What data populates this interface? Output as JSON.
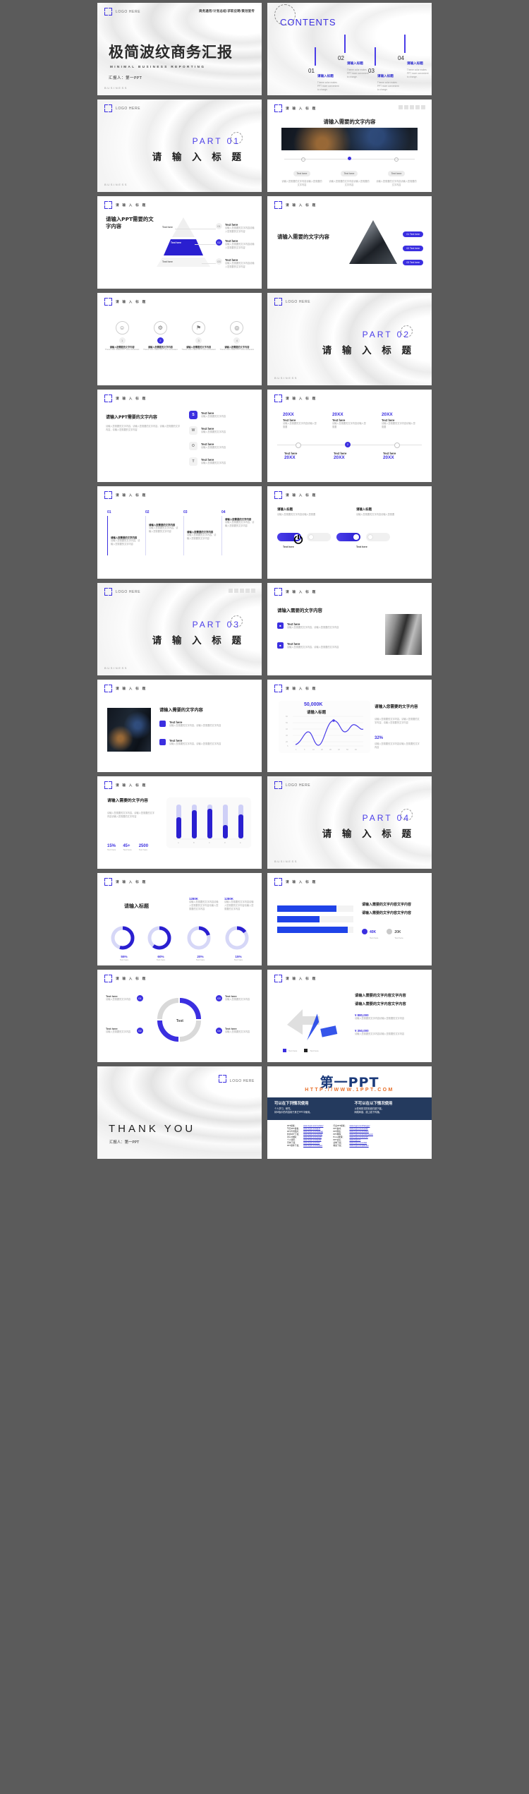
{
  "brand": {
    "accent": "#3b2fe0",
    "navy": "#243a5e",
    "orange": "#e8702a"
  },
  "common": {
    "logo_here": "LOGO HERE",
    "header_title": "请 输 入 标 题",
    "business": "BUSINESS",
    "text_here": "Text here",
    "placeholder_en": "Theme color makes PPT more convenient to change.",
    "placeholder_cn": "请输入您需要的文字内容，请输入您需要的文字内容，请输入您需要的文字内容"
  },
  "slides": [
    {
      "id": "cover",
      "tagline": "商务通用/计划总结/求职应聘/策划宣传",
      "title": "极简波纹商务汇报",
      "subtitle": "MINIMAL BUSINESS REPORTING",
      "presenter": "汇报人：第一PPT"
    },
    {
      "id": "contents",
      "title": "CONTENTS",
      "items": [
        {
          "num": "01",
          "label": "请输入标题",
          "desc": "Theme color makes PPT more convenient to change."
        },
        {
          "num": "02",
          "label": "请输入标题",
          "desc": "Theme color makes PPT more convenient to change."
        },
        {
          "num": "03",
          "label": "请输入标题",
          "desc": "Theme color makes PPT more convenient to change."
        },
        {
          "num": "04",
          "label": "请输入标题",
          "desc": "Theme color makes PPT more convenient to change."
        }
      ]
    },
    {
      "id": "part01",
      "part": "PART 01",
      "title": "请 输 入 标 题"
    },
    {
      "id": "city-cards",
      "title": "请输入需要的文字内容",
      "cards": [
        {
          "label": "Text here",
          "desc": "请输入您需要的文字内容请输入您需要的文字内容"
        },
        {
          "label": "Text here",
          "desc": "请输入您需要的文字内容请输入您需要的文字内容"
        },
        {
          "label": "Text here",
          "desc": "请输入您需要的文字内容请输入您需要的文字内容"
        }
      ]
    },
    {
      "id": "pyramid",
      "title": "请输入PPT需要的文字内容",
      "levels": [
        {
          "label": "Text here"
        },
        {
          "label": "Text here"
        },
        {
          "label": "Text here"
        }
      ],
      "rows": [
        {
          "num": "01",
          "label": "Text here",
          "desc": "请输入您需要的文字内容请输入您需要的文字内容"
        },
        {
          "num": "02",
          "label": "Text here",
          "desc": "请输入您需要的文字内容请输入您需要的文字内容"
        },
        {
          "num": "03",
          "label": "Text here",
          "desc": "请输入您需要的文字内容请输入您需要的文字内容"
        }
      ]
    },
    {
      "id": "triangle-photo",
      "title": "请输入需要的文字内容",
      "tags": [
        {
          "label": "01 Text here"
        },
        {
          "label": "02 Text here"
        },
        {
          "label": "03 Text here"
        }
      ]
    },
    {
      "id": "four-icons",
      "icons": [
        {
          "glyph": "☺",
          "num": "1",
          "label": "请输入您需要的文字内容",
          "desc": "Theme color makes PPT more convenient"
        },
        {
          "glyph": "⚙",
          "num": "2",
          "label": "请输入您需要的文字内容",
          "desc": "Theme color makes PPT more convenient"
        },
        {
          "glyph": "⚑",
          "num": "3",
          "label": "请输入您需要的文字内容",
          "desc": "Theme color makes PPT more convenient"
        },
        {
          "glyph": "◎",
          "num": "4",
          "label": "请输入您需要的文字内容",
          "desc": "Theme color makes PPT more convenient"
        }
      ]
    },
    {
      "id": "part02",
      "part": "PART 02",
      "title": "请 输 入 标 题"
    },
    {
      "id": "swot",
      "title": "请输入PPT需要的文字内容",
      "desc": "请输入您需要的文字内容，请输入您需要的文字内容，请输入您需要的文字内容，请输入您需要的文字内容",
      "items": [
        {
          "key": "S",
          "label": "Text here",
          "desc": "请输入您需要的文字内容"
        },
        {
          "key": "W",
          "label": "Text here",
          "desc": "请输入您需要的文字内容"
        },
        {
          "key": "O",
          "label": "Text here",
          "desc": "请输入您需要的文字内容"
        },
        {
          "key": "T",
          "label": "Text here",
          "desc": "请输入您需要的文字内容"
        }
      ]
    },
    {
      "id": "timeline",
      "top": [
        {
          "year": "20XX",
          "label": "Text here",
          "desc": "请输入您需要的文字内容请输入您需要"
        },
        {
          "year": "20XX",
          "label": "Text here",
          "desc": "请输入您需要的文字内容请输入您需要"
        },
        {
          "year": "20XX",
          "label": "Text here",
          "desc": "请输入您需要的文字内容请输入您需要"
        }
      ],
      "bottom": [
        {
          "year": "20XX",
          "label": "Text here"
        },
        {
          "year": "20XX",
          "label": "Text here"
        },
        {
          "year": "20XX",
          "label": "Text here"
        }
      ]
    },
    {
      "id": "steps",
      "items": [
        {
          "num": "01",
          "label": "请输入您需要的文字内容",
          "desc": "请输入您需要的文字内容，请输入您需要的文字内容"
        },
        {
          "num": "02",
          "label": "请输入您需要的文字内容",
          "desc": "请输入您需要的文字内容，请输入您需要的文字内容"
        },
        {
          "num": "03",
          "label": "请输入您需要的文字内容",
          "desc": "请输入您需要的文字内容，请输入您需要的文字内容"
        },
        {
          "num": "04",
          "label": "请输入您需要的文字内容",
          "desc": "请输入您需要的文字内容，请输入您需要的文字内容"
        }
      ]
    },
    {
      "id": "toggles",
      "headers": [
        {
          "label": "请输入标题",
          "desc": "请输入您需要的文字内容请输入您需要"
        },
        {
          "label": "请输入标题",
          "desc": "请输入您需要的文字内容请输入您需要"
        }
      ],
      "toggles": [
        {
          "state": "on",
          "label": "Text here"
        },
        {
          "state": "off",
          "label": ""
        },
        {
          "state": "on",
          "label": "Text here"
        },
        {
          "state": "off",
          "label": ""
        }
      ]
    },
    {
      "id": "part03",
      "part": "PART 03",
      "title": "请 输 入 标 题"
    },
    {
      "id": "list-photo",
      "title": "请输入需要的文字内容",
      "items": [
        {
          "label": "Text here",
          "desc": "请输入您需要的文字内容，请输入您需要的文字内容"
        },
        {
          "label": "Text here",
          "desc": "请输入您需要的文字内容，请输入您需要的文字内容"
        }
      ]
    },
    {
      "id": "photo-list",
      "title": "请输入需要的文字内容",
      "items": [
        {
          "label": "Text here",
          "desc": "请输入您需要的文字内容，请输入您需要的文字内容"
        },
        {
          "label": "Text here",
          "desc": "请输入您需要的文字内容，请输入您需要的文字内容"
        }
      ]
    },
    {
      "id": "line-chart",
      "value": "50,000K",
      "value_label": "请输入标题",
      "side_title": "请输入您需要的文字内容",
      "sub_value": "32%",
      "sub_label": "请输入您需要的文字内容请输入您需要的文字内容"
    },
    {
      "id": "bar-chart",
      "title": "请输入需要的文字内容",
      "desc": "请输入您需要的文字内容，请输入您需要的文字内容请输入您需要的文字内容",
      "stats": [
        {
          "value": "15%",
          "label": "Text here"
        },
        {
          "value": "45+",
          "label": "Text here"
        },
        {
          "value": "2500",
          "label": "Text here"
        }
      ]
    },
    {
      "id": "part04",
      "part": "PART 04",
      "title": "请 输 入 标 题"
    },
    {
      "id": "donuts",
      "title": "请输入标题",
      "notes": [
        {
          "value": "1280K",
          "desc": "请输入您需要的文字内容请输入您需要的文字内容请输入您需要的文字内容"
        },
        {
          "value": "1280K",
          "desc": "请输入您需要的文字内容请输入您需要的文字内容请输入您需要的文字内容"
        }
      ],
      "items": [
        {
          "pct": "55%",
          "value": 55,
          "label": "Text here"
        },
        {
          "pct": "60%",
          "value": 60,
          "label": "Text here"
        },
        {
          "pct": "20%",
          "value": 20,
          "label": "Text here"
        },
        {
          "pct": "15%",
          "value": 15,
          "label": "Text here"
        }
      ]
    },
    {
      "id": "hbar",
      "title": "请输入需要的文字内容文字内容",
      "title2": "请输入需要的文字内容文字内容",
      "bars": [
        {
          "value": 78
        },
        {
          "value": 55
        },
        {
          "value": 92
        }
      ],
      "metrics": [
        {
          "value": "40K",
          "label": "Text here"
        },
        {
          "value": "20K",
          "label": "Text here"
        }
      ]
    },
    {
      "id": "cycle",
      "center": "Text",
      "items": [
        {
          "num": "01",
          "label": "Text here",
          "desc": "请输入您需要的文字内容"
        },
        {
          "num": "02",
          "label": "Text here",
          "desc": "请输入您需要的文字内容"
        },
        {
          "num": "03",
          "label": "Text here",
          "desc": "请输入您需要的文字内容"
        },
        {
          "num": "04",
          "label": "Text here",
          "desc": "请输入您需要的文字内容"
        }
      ]
    },
    {
      "id": "arrow-stats",
      "title": "请输入需要的文字内容文字内容",
      "title2": "请输入需要的文字内容文字内容",
      "rows": [
        {
          "value": "¥ 880,000",
          "desc": "请输入您需要的文字内容请输入您需要的文字内容"
        },
        {
          "value": "¥ 350,000",
          "desc": "请输入您需要的文字内容请输入您需要的文字内容"
        }
      ],
      "legend": [
        {
          "label": "Text here"
        },
        {
          "label": "Text here"
        }
      ]
    },
    {
      "id": "thankyou",
      "title": "THANK YOU",
      "presenter": "汇报人：第一PPT"
    },
    {
      "id": "copyright",
      "logo": "第一PPT",
      "url": "HTTP://WWW.1PPT.COM",
      "allow_title": "可以在下列情况使用",
      "allow_items": [
        "个人学习、研究。",
        "将모板中的内容用于其它PPT中使用。"
      ],
      "deny_title": "不可以在以下情况使用",
      "deny_items": [
        "以任何形式的在线付费下载。",
        "网络转载、线上线下传播。"
      ],
      "links_left": [
        {
          "label": "PPT模板：",
          "url": "www.1ppt.com/moban/"
        },
        {
          "label": "节日PPT模板：",
          "url": "www.1ppt.com/jieri/"
        },
        {
          "label": "PPT背景图片：",
          "url": "www.1ppt.com/beijing/"
        },
        {
          "label": "优秀PPT下载：",
          "url": "www.1ppt.com/xiazai/"
        },
        {
          "label": "Word教程：",
          "url": "www.1ppt.com/word/"
        },
        {
          "label": "个人简历：",
          "url": "www.1ppt.com/jianli/"
        },
        {
          "label": "字体下载：",
          "url": "www.1ppt.com/ziti/"
        },
        {
          "label": "PPT课件下载：",
          "url": "www.1ppt.com/kejian/"
        }
      ],
      "links_right": [
        {
          "label": "行业PPT模板：",
          "url": "www.1ppt.com/hangye/"
        },
        {
          "label": "PPT素材：",
          "url": "www.1ppt.com/sucai/"
        },
        {
          "label": "PPT图表：",
          "url": "www.1ppt.com/tubiao/"
        },
        {
          "label": "PPT教程：",
          "url": "www.1ppt.com/powerpoint/"
        },
        {
          "label": "Excel教程：",
          "url": "www.1ppt.com/excel/"
        },
        {
          "label": "PPT论坛：",
          "url": "www.1ppt.cn"
        },
        {
          "label": "试卷下载：",
          "url": "www.1ppt.com/shiti/"
        },
        {
          "label": "教案下载：",
          "url": "www.1ppt.com/jiaoan/"
        }
      ]
    }
  ]
}
